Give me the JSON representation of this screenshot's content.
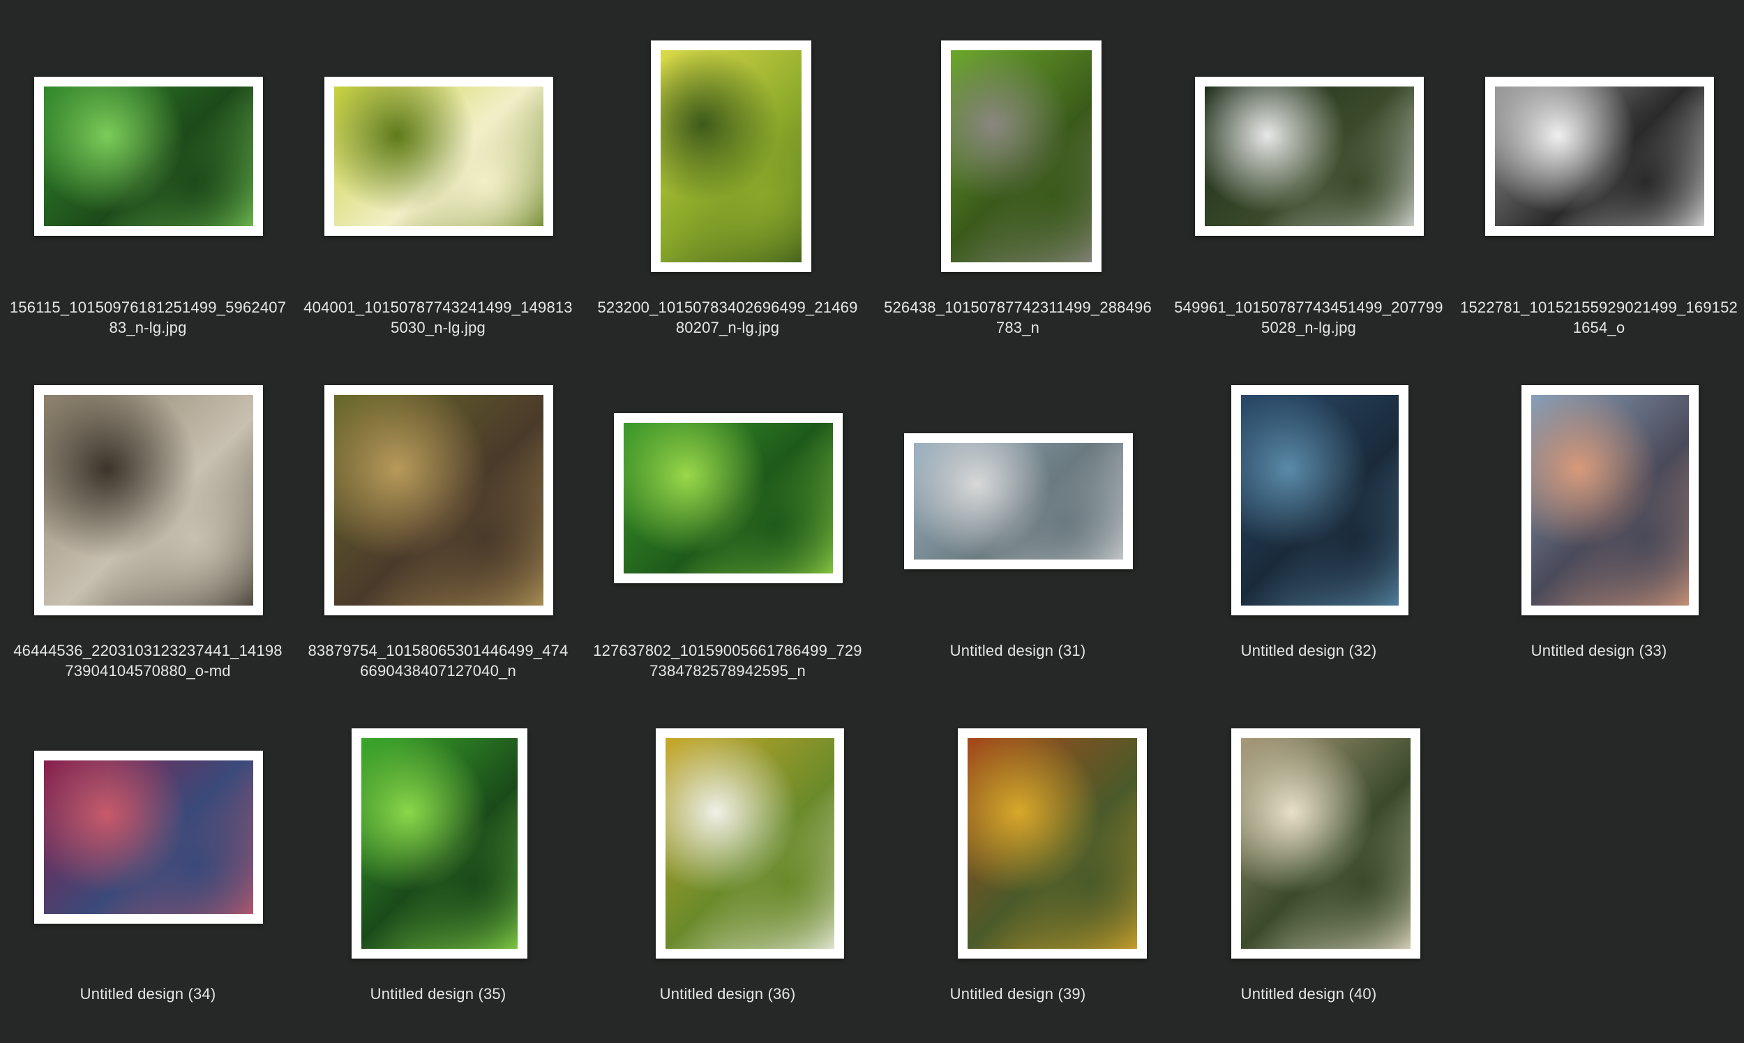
{
  "files": [
    {
      "name": "156115_10150976181251499_596240783_n-lg.jpg",
      "line1": "156115_10150976181251499_5962407",
      "line2": "83_n-lg.jpg",
      "image": "lily-pads-with-water-drops",
      "colors": [
        "#2f8a2a",
        "#7ccc5a",
        "#1d4a1a"
      ]
    },
    {
      "name": "404001_10150787743241499_1498135030_n-lg.jpg",
      "line1": "404001_10150787743241499_149813",
      "line2": "5030_n-lg.jpg",
      "image": "yellow-green-leaves-canopy",
      "colors": [
        "#c9d23a",
        "#5e7a1a",
        "#f2efc8"
      ]
    },
    {
      "name": "523200_10150783402696499_2146980207_n-lg.jpg",
      "line1": "523200_10150783402696499_21469",
      "line2": "80207_n-lg.jpg",
      "image": "backlit-yellow-leaf",
      "colors": [
        "#dada4a",
        "#3d5a1a",
        "#8aa82a"
      ]
    },
    {
      "name": "526438_10150787742311499_288496783_n",
      "line1": "526438_10150787742311499_288496",
      "line2": "783_n",
      "image": "moss-on-paving-stones",
      "colors": [
        "#6ba82a",
        "#8a8680",
        "#3a5a1a"
      ]
    },
    {
      "name": "549961_10150787743451499_2077995028_n-lg.jpg",
      "line1": "549961_10150787743451499_207799",
      "line2": "5028_n-lg.jpg",
      "image": "dandelion-seed-head",
      "colors": [
        "#1e2e1c",
        "#e8e8e8",
        "#3a4a2a"
      ]
    },
    {
      "name": "1522781_10152155929021499_1691521654_o",
      "line1": "1522781_10152155929021499_169152",
      "line2": "1654_o",
      "image": "frost-on-branches-bw",
      "colors": [
        "#9a9a9a",
        "#f0f0f0",
        "#2a2a2a"
      ]
    },
    {
      "name": "46444536_2203103123237441_1419873904104570880_o-md",
      "line1": "46444536_2203103123237441_14198",
      "line2": "73904104570880_o-md",
      "image": "tree-bark-texture",
      "colors": [
        "#8a7e6a",
        "#3a342a",
        "#c8c0b0"
      ]
    },
    {
      "name": "83879754_10158065301446499_4746690438407127040_n",
      "line1": "83879754_10158065301446499_474",
      "line2": "6690438407127040_n",
      "image": "mossy-forest-floor",
      "colors": [
        "#6a6a2a",
        "#b89a5a",
        "#4a3a2a"
      ]
    },
    {
      "name": "127637802_10159005661786499_7297384782578942595_n",
      "line1": "127637802_10159005661786499_729",
      "line2": "7384782578942595_n",
      "image": "green-leaf-veins-macro",
      "colors": [
        "#3a9a2a",
        "#9ad84a",
        "#1e5a1a"
      ]
    },
    {
      "name": "Untitled design (31)",
      "line1": "Untitled design (31)",
      "line2": "",
      "image": "fog-over-landscape",
      "colors": [
        "#9ab0c0",
        "#d8d8d8",
        "#6a7a80"
      ]
    },
    {
      "name": "Untitled design (32)",
      "line1": "Untitled design (32)",
      "line2": "",
      "image": "storm-clouds",
      "colors": [
        "#2a4a6a",
        "#5a8aa8",
        "#1a2a3a"
      ]
    },
    {
      "name": "Untitled design (33)",
      "line1": "Untitled design (33)",
      "line2": "",
      "image": "sunset-clouds",
      "colors": [
        "#8aa0b8",
        "#d89a7a",
        "#4a4a5a"
      ]
    },
    {
      "name": "Untitled design (34)",
      "line1": "Untitled design (34)",
      "line2": "",
      "image": "hydrangea-flowers",
      "colors": [
        "#8a1e4a",
        "#c85a6a",
        "#3a4a7a"
      ]
    },
    {
      "name": "Untitled design (35)",
      "line1": "Untitled design (35)",
      "line2": "",
      "image": "round-green-leaves",
      "colors": [
        "#3aa82a",
        "#8ad84a",
        "#1a4a1a"
      ]
    },
    {
      "name": "Untitled design (36)",
      "line1": "Untitled design (36)",
      "line2": "",
      "image": "white-dogwood-blossoms",
      "colors": [
        "#c8a82a",
        "#f0f0e8",
        "#6a8a2a"
      ]
    },
    {
      "name": "Untitled design (39)",
      "line1": "Untitled design (39)",
      "line2": "",
      "image": "autumn-forest-aerial-sunset",
      "colors": [
        "#a84a1a",
        "#d8a82a",
        "#4a5a2a"
      ]
    },
    {
      "name": "Untitled design (40)",
      "line1": "Untitled design (40)",
      "line2": "",
      "image": "grass-plumes",
      "colors": [
        "#a89a7a",
        "#e8e0c8",
        "#3a4a2a"
      ]
    }
  ]
}
